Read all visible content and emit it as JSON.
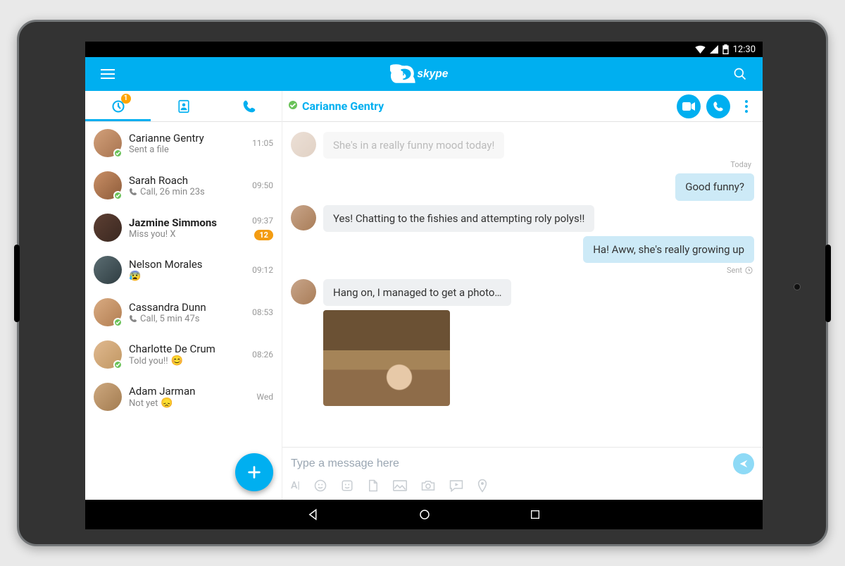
{
  "statusbar": {
    "time": "12:30"
  },
  "app": {
    "logo_text": "skype"
  },
  "tabs": {
    "recent_badge": "1"
  },
  "conversations": [
    {
      "name": "Carianne Gentry",
      "sub": "Sent a file",
      "time": "11:05",
      "bold": false,
      "presence": true,
      "call": false,
      "emoji": "",
      "badge": ""
    },
    {
      "name": "Sarah Roach",
      "sub": "Call, 26 min 23s",
      "time": "09:50",
      "bold": false,
      "presence": true,
      "call": true,
      "emoji": "",
      "badge": ""
    },
    {
      "name": "Jazmine Simmons",
      "sub": "Miss you! X",
      "time": "09:37",
      "bold": true,
      "presence": false,
      "call": false,
      "emoji": "",
      "badge": "12"
    },
    {
      "name": "Nelson Morales",
      "sub": "",
      "time": "09:12",
      "bold": false,
      "presence": false,
      "call": false,
      "emoji": "😰",
      "badge": ""
    },
    {
      "name": "Cassandra Dunn",
      "sub": "Call, 5 min 47s",
      "time": "08:53",
      "bold": false,
      "presence": true,
      "call": true,
      "emoji": "",
      "badge": ""
    },
    {
      "name": "Charlotte De Crum",
      "sub": "Told you!!",
      "time": "08:26",
      "bold": false,
      "presence": true,
      "call": false,
      "emoji": "😊",
      "badge": ""
    },
    {
      "name": "Adam Jarman",
      "sub": "Not yet",
      "time": "Wed",
      "bold": false,
      "presence": false,
      "call": false,
      "emoji": "😞",
      "badge": ""
    }
  ],
  "chat": {
    "title": "Carianne Gentry",
    "day": "Today",
    "faded": "She's in a really funny mood today!",
    "m_out_1": "Good funny?",
    "m_in_1": "Yes! Chatting to the fishies and attempting roly polys!!",
    "m_out_2": "Ha! Aww, she's really growing up",
    "sent": "Sent",
    "m_in_2": "Hang on, I managed to get a photo…"
  },
  "composer": {
    "placeholder": "Type a message here",
    "font_label": "A|"
  }
}
